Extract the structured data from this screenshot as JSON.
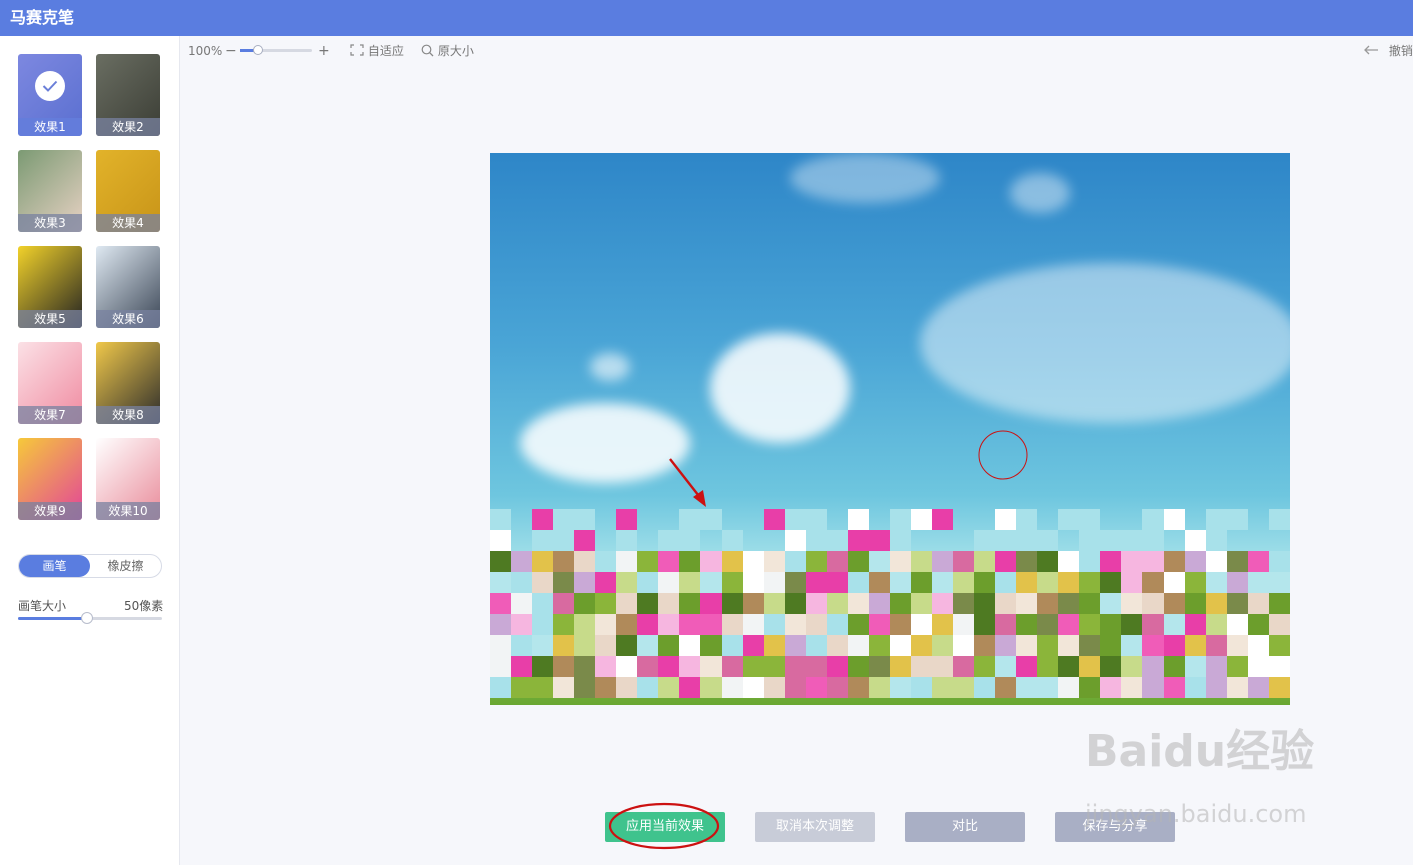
{
  "app": {
    "title": "马赛克笔"
  },
  "effects": [
    {
      "label": "效果1",
      "colors": [
        "#7d88e0",
        "#5a6fd0"
      ],
      "selected": true
    },
    {
      "label": "效果2",
      "colors": [
        "#6a6e62",
        "#3b3d35"
      ],
      "selected": false
    },
    {
      "label": "效果3",
      "colors": [
        "#7b9a73",
        "#e8d2c4"
      ],
      "selected": false
    },
    {
      "label": "效果4",
      "colors": [
        "#e2b32a",
        "#c89418"
      ],
      "selected": false
    },
    {
      "label": "效果5",
      "colors": [
        "#f2d22a",
        "#222222"
      ],
      "selected": false
    },
    {
      "label": "效果6",
      "colors": [
        "#dfe9f2",
        "#3a4555"
      ],
      "selected": false
    },
    {
      "label": "效果7",
      "colors": [
        "#fbe1e6",
        "#f08aa0"
      ],
      "selected": false
    },
    {
      "label": "效果8",
      "colors": [
        "#f0c84a",
        "#2b2b2b"
      ],
      "selected": false
    },
    {
      "label": "效果9",
      "colors": [
        "#f6c93a",
        "#e2439a"
      ],
      "selected": false
    },
    {
      "label": "效果10",
      "colors": [
        "#ffffff",
        "#e98b9a"
      ],
      "selected": false
    }
  ],
  "tool_toggle": {
    "brush": "画笔",
    "eraser": "橡皮擦"
  },
  "brush_size": {
    "label": "画笔大小",
    "value_text": "50像素",
    "level": 0.48
  },
  "toolbar": {
    "zoom_text": "100%",
    "zoom_minus": "−",
    "zoom_plus": "+",
    "zoom_level": 0.25,
    "fit_label": "自适应",
    "original_label": "原大小",
    "undo_label": "撤销"
  },
  "buttons": {
    "apply": "应用当前效果",
    "cancel": "取消本次调整",
    "compare": "对比",
    "save": "保存与分享"
  },
  "watermark": {
    "brand": "Baidu经验",
    "url": "jingyan.baidu.com"
  },
  "colors": {
    "accent": "#5a7de0",
    "apply_green": "#3fc38d",
    "gray_btn": "#a9afc5",
    "annotation_red": "#cc1111"
  }
}
